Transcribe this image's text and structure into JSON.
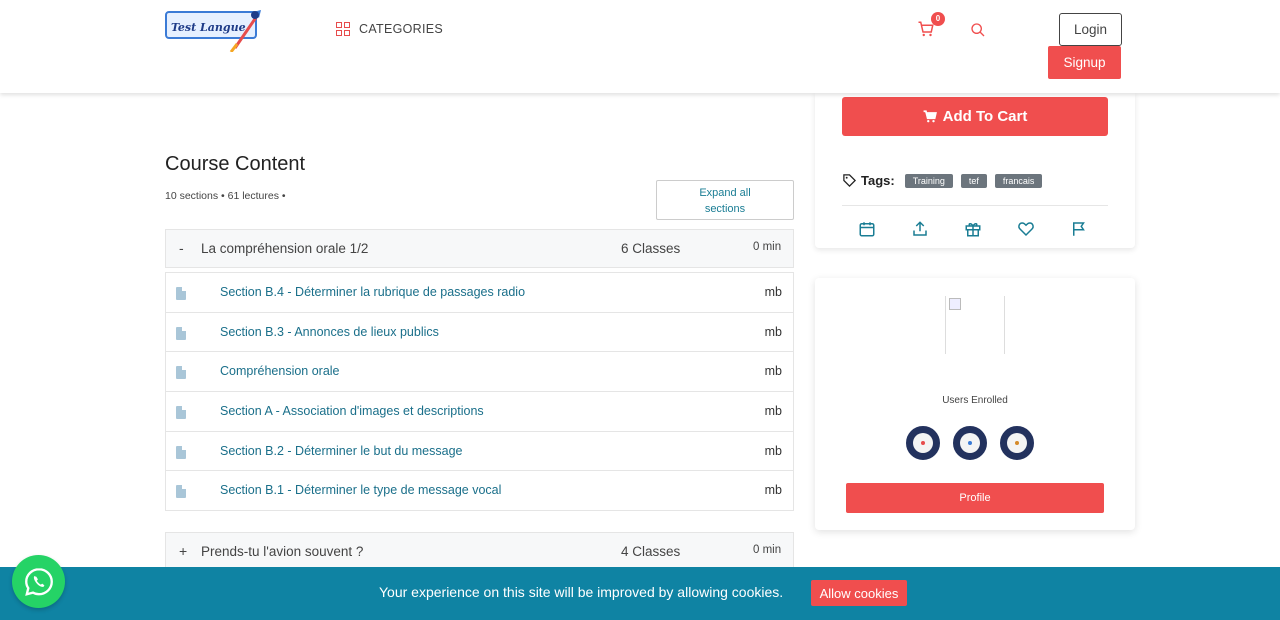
{
  "header": {
    "logo_text": "Test Langue",
    "categories_label": "CATEGORIES",
    "cart_count": "0",
    "login_label": "Login",
    "signup_label": "Signup"
  },
  "sidebar_card": {
    "add_to_cart_label": "Add To Cart",
    "tags_label": "Tags:",
    "tags": [
      "Training",
      "tef",
      "francais"
    ],
    "actions": [
      "calendar-icon",
      "share-icon",
      "gift-icon",
      "heart-icon",
      "flag-icon"
    ]
  },
  "instructor_card": {
    "users_enrolled_label": "Users Enrolled",
    "profile_label": "Profile"
  },
  "course_content": {
    "title": "Course Content",
    "meta": "10 sections • 61 lectures •",
    "expand_label_line1": "Expand all",
    "expand_label_line2": "sections",
    "sections": [
      {
        "toggle": "-",
        "name": "La compréhension orale 1/2",
        "classes": "6 Classes",
        "duration": "0 min",
        "lectures": [
          {
            "title": "Section B.4 - Déterminer la rubrique de passages radio",
            "size": "mb"
          },
          {
            "title": "Section B.3 - Annonces de lieux publics",
            "size": "mb"
          },
          {
            "title": "Compréhension orale",
            "size": "mb"
          },
          {
            "title": "Section A - Association d'images et descriptions",
            "size": "mb"
          },
          {
            "title": "Section B.2 - Déterminer le but du message",
            "size": "mb"
          },
          {
            "title": "Section B.1 - Déterminer le type de message vocal",
            "size": "mb"
          }
        ]
      },
      {
        "toggle": "+",
        "name": "Prends-tu l'avion souvent ?",
        "classes": "4 Classes",
        "duration": "0 min"
      }
    ]
  },
  "cookie_bar": {
    "text": "Your experience on this site will be improved by allowing cookies.",
    "allow_label": "Allow cookies"
  },
  "colors": {
    "accent": "#f04e4e",
    "link": "#1a6f8a",
    "cookie_bg": "#0f83a3",
    "whatsapp": "#25d366"
  }
}
